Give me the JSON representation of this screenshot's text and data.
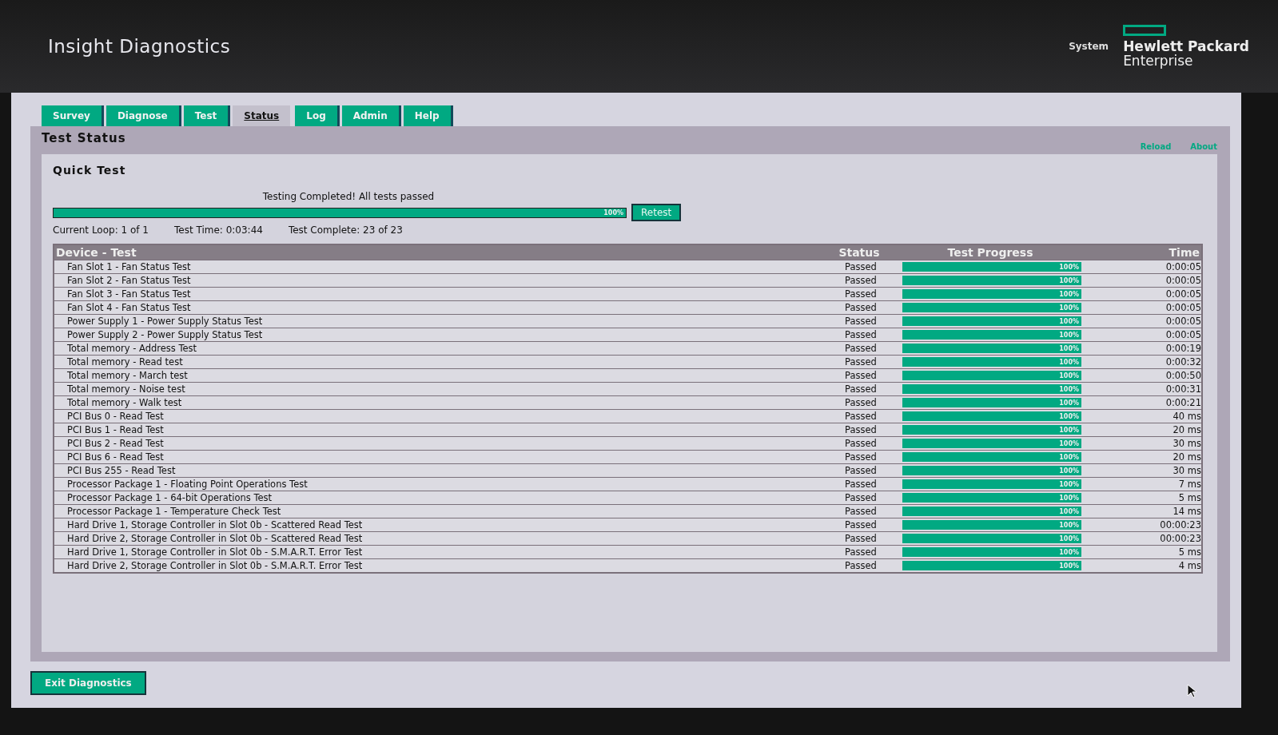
{
  "header": {
    "title": "Insight Diagnostics",
    "system_label": "System",
    "brand_line_1": "Hewlett Packard",
    "brand_line_2": "Enterprise"
  },
  "tabs": [
    {
      "label": "Survey",
      "selected": false
    },
    {
      "label": "Diagnose",
      "selected": false
    },
    {
      "label": "Test",
      "selected": false
    },
    {
      "label": "Status",
      "selected": true
    },
    {
      "label": "Log",
      "selected": false
    },
    {
      "label": "Admin",
      "selected": false
    },
    {
      "label": "Help",
      "selected": false
    }
  ],
  "panel": {
    "title": "Test Status",
    "links": [
      "Reload",
      "About"
    ]
  },
  "quick_test": {
    "title": "Quick Test",
    "message": "Testing Completed! All tests passed",
    "level": 1,
    "percent": "100%",
    "retest_button": "Retest",
    "current_loop": "Current Loop: 1 of 1",
    "test_time": "Test Time: 0:03:44",
    "test_complete": "Test Complete: 23 of 23"
  },
  "table": {
    "columns": [
      "Device - Test",
      "Status",
      "Test Progress",
      "Time"
    ],
    "rows": [
      {
        "test": "Fan Slot 1 - Fan Status Test",
        "status": "Passed",
        "level": 1,
        "percent": "100%",
        "time": "0:00:05"
      },
      {
        "test": "Fan Slot 2 - Fan Status Test",
        "status": "Passed",
        "level": 1,
        "percent": "100%",
        "time": "0:00:05"
      },
      {
        "test": "Fan Slot 3 - Fan Status Test",
        "status": "Passed",
        "level": 1,
        "percent": "100%",
        "time": "0:00:05"
      },
      {
        "test": "Fan Slot 4 - Fan Status Test",
        "status": "Passed",
        "level": 1,
        "percent": "100%",
        "time": "0:00:05"
      },
      {
        "test": "Power Supply 1 - Power Supply Status Test",
        "status": "Passed",
        "level": 1,
        "percent": "100%",
        "time": "0:00:05"
      },
      {
        "test": "Power Supply 2 - Power Supply Status Test",
        "status": "Passed",
        "level": 1,
        "percent": "100%",
        "time": "0:00:05"
      },
      {
        "test": "Total memory - Address Test",
        "status": "Passed",
        "level": 1,
        "percent": "100%",
        "time": "0:00:19"
      },
      {
        "test": "Total memory - Read test",
        "status": "Passed",
        "level": 1,
        "percent": "100%",
        "time": "0:00:32"
      },
      {
        "test": "Total memory - March test",
        "status": "Passed",
        "level": 1,
        "percent": "100%",
        "time": "0:00:50"
      },
      {
        "test": "Total memory - Noise test",
        "status": "Passed",
        "level": 1,
        "percent": "100%",
        "time": "0:00:31"
      },
      {
        "test": "Total memory - Walk test",
        "status": "Passed",
        "level": 1,
        "percent": "100%",
        "time": "0:00:21"
      },
      {
        "test": "PCI Bus 0 - Read Test",
        "status": "Passed",
        "level": 1,
        "percent": "100%",
        "time": "40 ms"
      },
      {
        "test": "PCI Bus 1 - Read Test",
        "status": "Passed",
        "level": 1,
        "percent": "100%",
        "time": "20 ms"
      },
      {
        "test": "PCI Bus 2 - Read Test",
        "status": "Passed",
        "level": 1,
        "percent": "100%",
        "time": "30 ms"
      },
      {
        "test": "PCI Bus 6 - Read Test",
        "status": "Passed",
        "level": 1,
        "percent": "100%",
        "time": "20 ms"
      },
      {
        "test": "PCI Bus 255 - Read Test",
        "status": "Passed",
        "level": 1,
        "percent": "100%",
        "time": "30 ms"
      },
      {
        "test": "Processor Package 1 - Floating Point Operations Test",
        "status": "Passed",
        "level": 1,
        "percent": "100%",
        "time": "7 ms"
      },
      {
        "test": "Processor Package 1 - 64-bit Operations Test",
        "status": "Passed",
        "level": 1,
        "percent": "100%",
        "time": "5 ms"
      },
      {
        "test": "Processor Package 1 - Temperature Check Test",
        "status": "Passed",
        "level": 1,
        "percent": "100%",
        "time": "14 ms"
      },
      {
        "test": "Hard Drive 1, Storage Controller in Slot 0b - Scattered Read Test",
        "status": "Passed",
        "level": 1,
        "percent": "100%",
        "time": "00:00:23"
      },
      {
        "test": "Hard Drive 2, Storage Controller in Slot 0b - Scattered Read Test",
        "status": "Passed",
        "level": 1,
        "percent": "100%",
        "time": "00:00:23"
      },
      {
        "test": "Hard Drive 1, Storage Controller in Slot 0b - S.M.A.R.T. Error Test",
        "status": "Passed",
        "level": 1,
        "percent": "100%",
        "time": "5 ms"
      },
      {
        "test": "Hard Drive 2, Storage Controller in Slot 0b - S.M.A.R.T. Error Test",
        "status": "Passed",
        "level": 1,
        "percent": "100%",
        "time": "4 ms"
      }
    ]
  },
  "exit_button": "Exit Diagnostics"
}
